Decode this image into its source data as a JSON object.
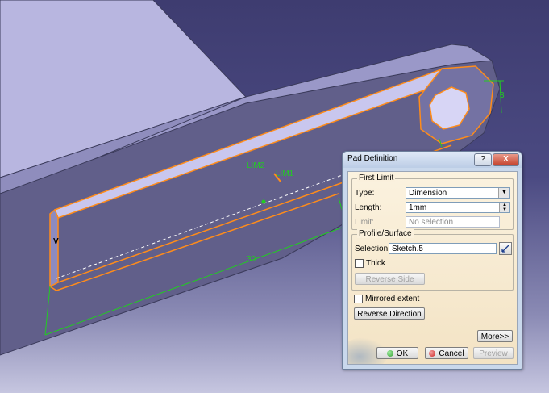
{
  "viewport": {
    "labels": {
      "lim2": "LIM2",
      "lim1": "LIM1",
      "v": "V",
      "dim_30": "30",
      "dim_3": "3"
    },
    "colors": {
      "background_top": "#3e3c70",
      "background_bottom": "#c6c6e0",
      "part_top_face": "#b8b6e0",
      "part_side_face": "#5d5b85",
      "highlight_orange": "#ff8c1a",
      "dimension_green": "#22cc22"
    }
  },
  "dialog": {
    "title": "Pad Definition",
    "help_label": "?",
    "close_label": "X",
    "first_limit": {
      "legend": "First Limit",
      "type_label": "Type:",
      "type_value": "Dimension",
      "length_label": "Length:",
      "length_value": "1mm",
      "limit_label": "Limit:",
      "limit_value": "No selection"
    },
    "profile": {
      "legend": "Profile/Surface",
      "selection_label": "Selection:",
      "selection_value": "Sketch.5",
      "thick_label": "Thick",
      "reverse_side_label": "Reverse Side"
    },
    "mirrored_extent_label": "Mirrored extent",
    "reverse_direction_label": "Reverse Direction",
    "more_label": "More>>",
    "ok_label": "OK",
    "cancel_label": "Cancel",
    "preview_label": "Preview",
    "colors": {
      "ok_dot": "#2e9b2e",
      "cancel_dot": "#cc2222"
    }
  }
}
